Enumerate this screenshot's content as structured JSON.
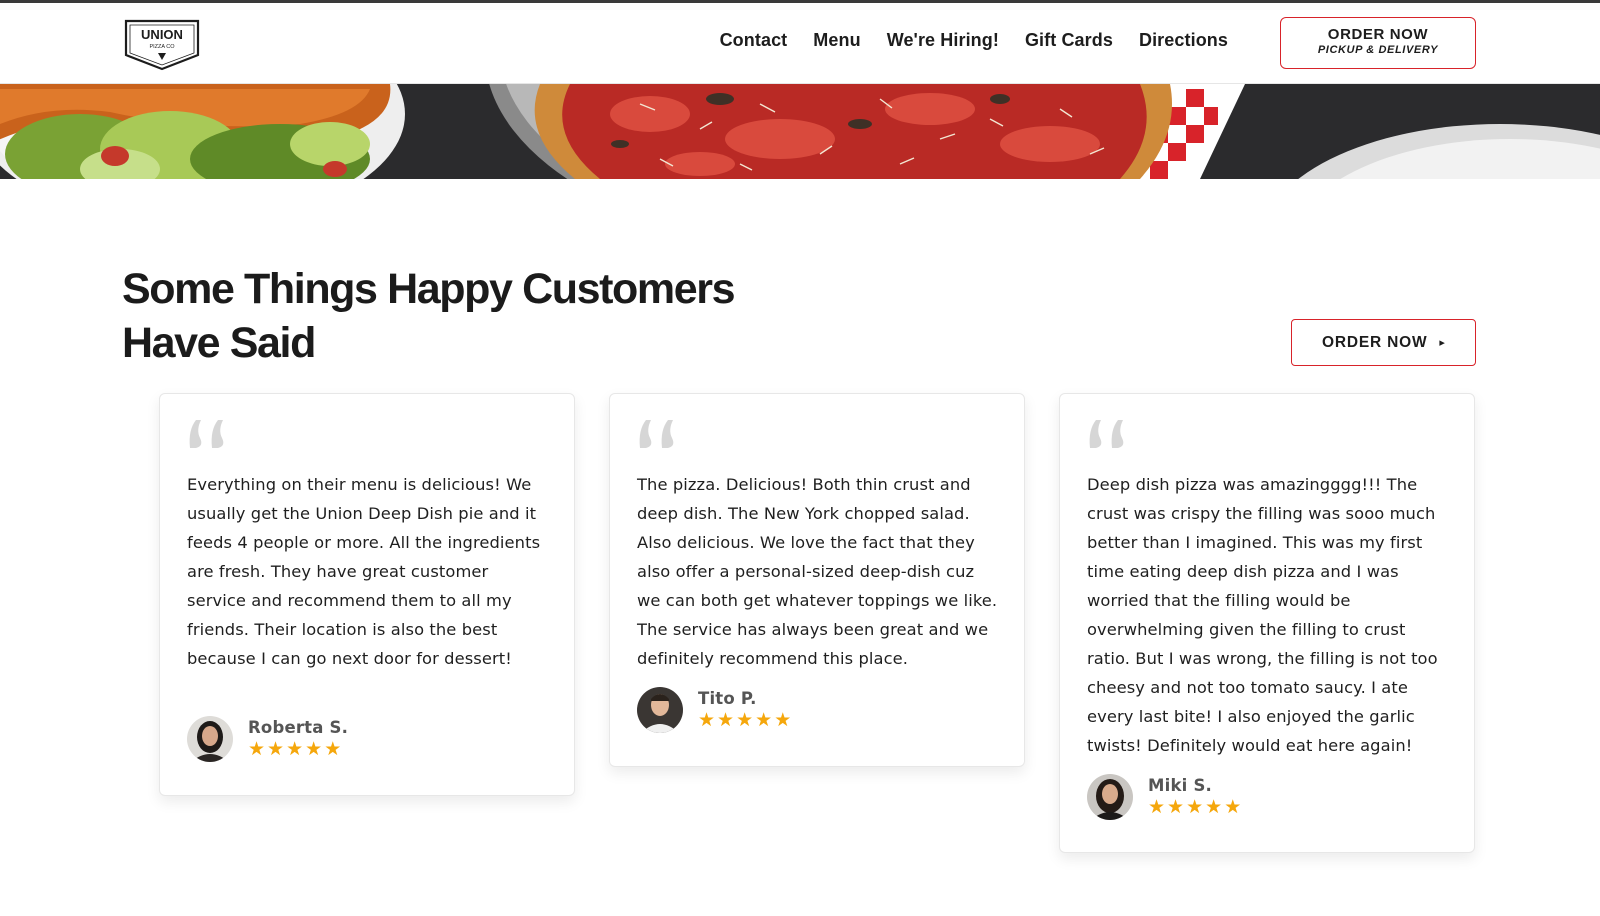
{
  "header": {
    "logo_text": "UNION",
    "logo_subtext": "PIZZA CO",
    "nav": [
      "Contact",
      "Menu",
      "We're Hiring!",
      "Gift Cards",
      "Directions"
    ],
    "order_button": {
      "line1": "ORDER NOW",
      "line2": "PICKUP & DELIVERY"
    }
  },
  "section": {
    "title_line1": "Some Things Happy Customers",
    "title_line2": "Have Said",
    "order_button": "ORDER NOW"
  },
  "reviews": [
    {
      "text": "Everything on their menu is delicious! We usually get the Union Deep Dish pie and it feeds 4 people or more. All the ingredients are fresh. They have great customer service and recommend them to all my friends. Their location is also the best because I can go next door for dessert!",
      "author": "Roberta S.",
      "rating": 5
    },
    {
      "text": "The pizza. Delicious! Both thin crust and deep dish. The New York chopped salad. Also delicious. We love the fact that they also offer a personal-sized deep-dish cuz we can both get whatever toppings we like. The service has always been great and we definitely recommend this place.",
      "author": "Tito P.",
      "rating": 5
    },
    {
      "text": "Deep dish pizza was amazingggg!!! The crust was crispy the filling was sooo much better than I imagined. This was my first time eating deep dish pizza and I was worried that the filling would be overwhelming given the filling to crust ratio. But I was wrong, the filling is not too cheesy and not too tomato saucy. I ate every last bite! I also enjoyed the garlic twists! Definitely would eat here again!",
      "author": "Miki S.",
      "rating": 5
    }
  ],
  "colors": {
    "accent_red": "#d8232a",
    "star_yellow": "#f5a70c",
    "text_dark": "#1b1b1b"
  }
}
